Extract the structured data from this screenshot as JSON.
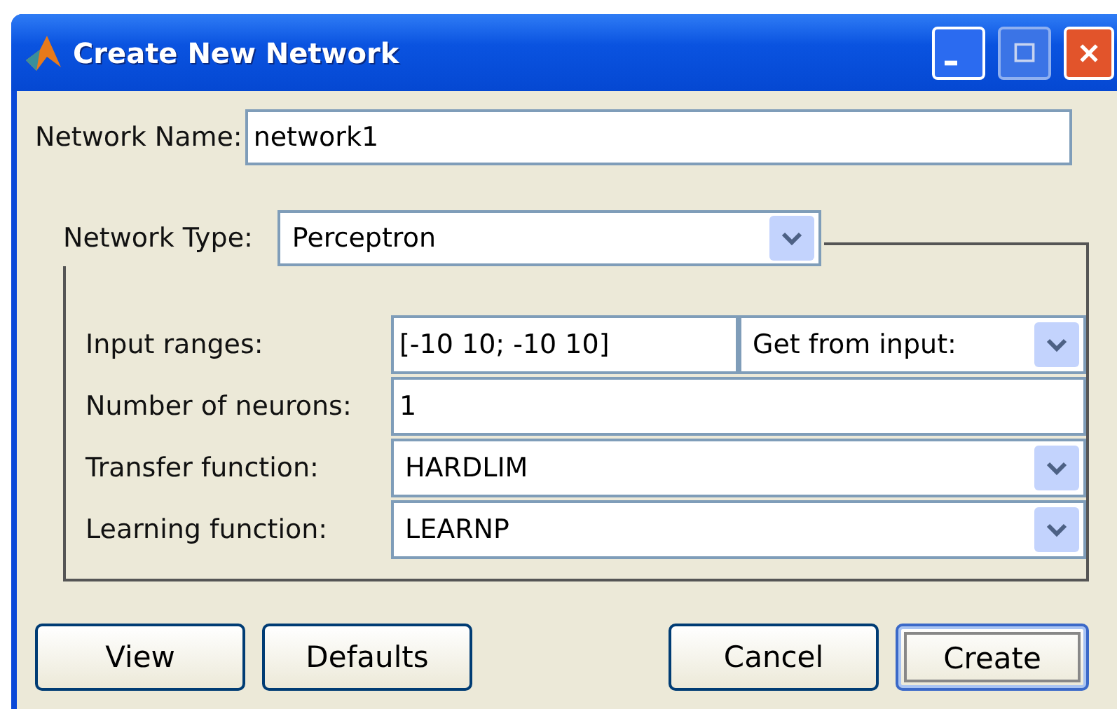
{
  "window": {
    "title": "Create New Network"
  },
  "network_name": {
    "label": "Network Name:",
    "value": "network1"
  },
  "network_type": {
    "label": "Network Type:",
    "value": "Perceptron"
  },
  "parameters": [
    {
      "kind": "text-with-dropdown",
      "label": "Input ranges:",
      "value": "[-10 10; -10 10]",
      "option": "Get from input:"
    },
    {
      "kind": "text",
      "label": "Number of neurons:",
      "value": "1"
    },
    {
      "kind": "dropdown",
      "label": "Transfer function:",
      "value": "HARDLIM"
    },
    {
      "kind": "dropdown",
      "label": "Learning function:",
      "value": "LEARNP"
    }
  ],
  "buttons_left": [
    {
      "label": "View",
      "default": false
    },
    {
      "label": "Defaults",
      "default": false
    }
  ],
  "buttons_right": [
    {
      "label": "Cancel",
      "default": false
    },
    {
      "label": "Create",
      "default": true
    }
  ]
}
